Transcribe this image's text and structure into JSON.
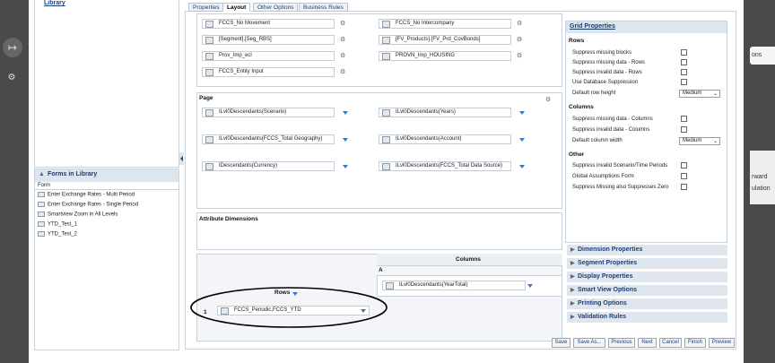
{
  "library": {
    "top_link": "Library",
    "forms_header": "Forms in Library",
    "column_header": "Form",
    "items": [
      "Enter Exchange Rates - Multi Period",
      "Enter Exchange Rates - Single Period",
      "Smartview Zoom in All Levels",
      "YTD_Test_1",
      "YTD_Test_2"
    ]
  },
  "tabs": [
    "Properties",
    "Layout",
    "Other Options",
    "Business Rules"
  ],
  "pov": [
    "FCCS_No Movement",
    "FCCS_No Intercompany",
    "[Segment].[Seg_RBS]",
    "[FV_Products].[FV_Prd_CovBonds]",
    "Prov_Imp_ecl",
    "PROVN_Imp_HOUSING",
    "FCCS_Entity Input"
  ],
  "page": {
    "label": "Page",
    "items": [
      "ILvl0Descendants(Scenario)",
      "ILvl0Descendants(Years)",
      "ILvl0Descendants(FCCS_Total Geography)",
      "ILvl0Descendants(Account)",
      "IDescendants(Currency)",
      "ILvl0Descendants(FCCS_Total Data Source)"
    ]
  },
  "attribute_dimensions": "Attribute Dimensions",
  "columns": {
    "label": "Columns",
    "letter": "A",
    "item": "ILvl0Descendants(YearTotal)"
  },
  "rows": {
    "label": "Rows",
    "number": "1",
    "item": "FCCS_Periodic,FCCS_YTD"
  },
  "grid_properties": {
    "title": "Grid Properties",
    "rows_label": "Rows",
    "rows_options": [
      "Suppress missing blocks",
      "Suppress missing data - Rows",
      "Suppress invalid data - Rows",
      "Use Database Suppression"
    ],
    "default_row_height_label": "Default row height",
    "default_row_height_value": "Medium",
    "columns_label": "Columns",
    "columns_options": [
      "Suppress missing data - Columns",
      "Suppress invalid data - Columns"
    ],
    "default_column_width_label": "Default column width",
    "default_column_width_value": "Medium",
    "other_label": "Other",
    "other_options": [
      "Suppress invalid Scenario/Time Periods",
      "Global Assumptions Form",
      "Suppress Missing also Suppresses Zero"
    ]
  },
  "accordions": [
    "Dimension Properties",
    "Segment Properties",
    "Display Properties",
    "Smart View Options",
    "Printing Options",
    "Validation Rules"
  ],
  "buttons": [
    "Save",
    "Save As...",
    "Previous",
    "Next",
    "Cancel",
    "Finish",
    "Preview"
  ],
  "right_strip": {
    "item1": "ons",
    "item2": "rward",
    "item3": "ulation"
  },
  "icons": {
    "gear": "gear-icon",
    "member": "member-selector-icon",
    "dropdown": "dropdown-arrow-icon"
  }
}
